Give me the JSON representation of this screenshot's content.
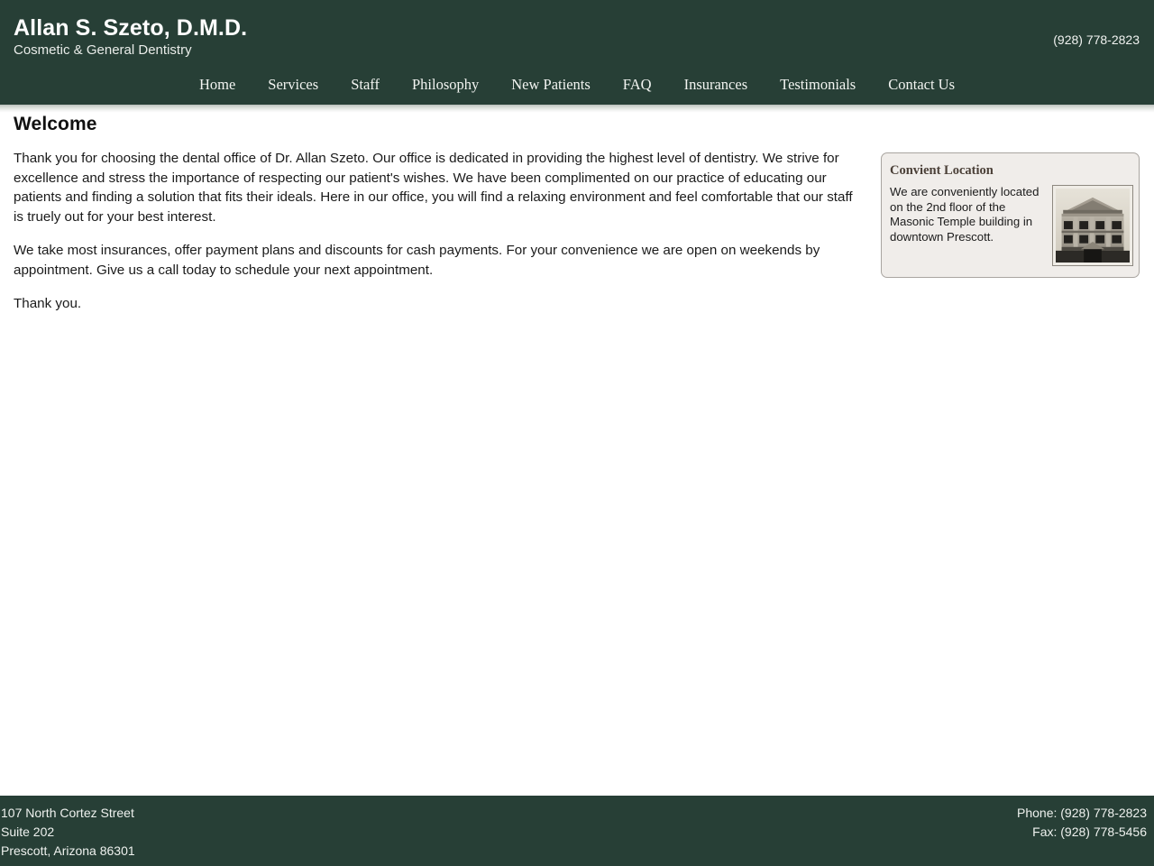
{
  "header": {
    "practice_name": "Allan S. Szeto, D.M.D.",
    "tagline": "Cosmetic & General Dentistry",
    "phone": "(928) 778-2823",
    "background_color": "#273f36"
  },
  "nav": {
    "items": [
      {
        "label": "Home"
      },
      {
        "label": "Services"
      },
      {
        "label": "Staff"
      },
      {
        "label": "Philosophy"
      },
      {
        "label": "New Patients"
      },
      {
        "label": "FAQ"
      },
      {
        "label": "Insurances"
      },
      {
        "label": "Testimonials"
      },
      {
        "label": "Contact Us"
      }
    ]
  },
  "main": {
    "title": "Welcome",
    "paragraphs": [
      "Thank you for choosing the dental office of Dr. Allan Szeto. Our office is dedicated in providing the highest level of dentistry. We strive for excellence and stress the importance of respecting our patient's wishes. We have been complimented on our practice of educating our patients and finding a solution that fits their ideals. Here in our office, you will find a relaxing environment and feel comfortable that our staff is truely out for your best interest.",
      "We take most insurances, offer payment plans and discounts for cash payments. For your convenience we are open on weekends by appointment. Give us a call today to schedule your next appointment.",
      "Thank you."
    ]
  },
  "sidebar": {
    "card": {
      "heading": "Convient Location",
      "text": "We are conveniently located on the 2nd floor of the Masonic Temple building in downtown Prescott.",
      "photo_alt": "masonic-temple-building-photo",
      "background_color": "#f0edea",
      "border_color": "#a9a5a0",
      "heading_color": "#4b4038"
    }
  },
  "footer": {
    "address": [
      "107 North Cortez Street",
      "Suite 202",
      "Prescott, Arizona 86301"
    ],
    "contact": [
      "Phone: (928) 778-2823",
      "Fax: (928) 778-5456"
    ],
    "background_color": "#273f36"
  }
}
